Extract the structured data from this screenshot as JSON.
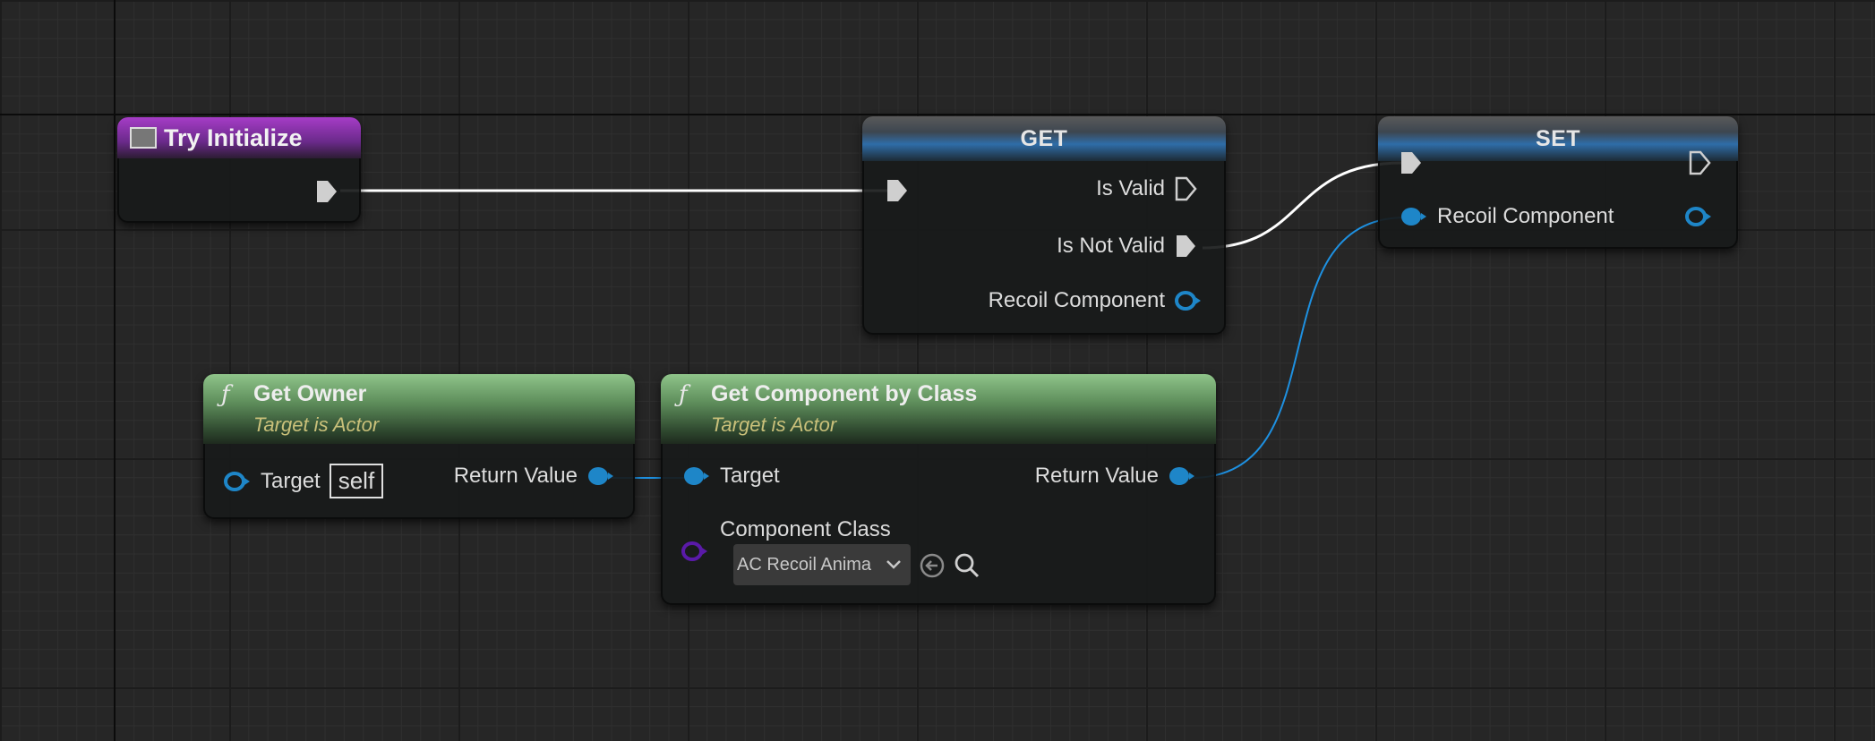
{
  "event_node": {
    "title": "Try Initialize"
  },
  "get_node": {
    "title": "GET",
    "pins": {
      "is_valid": "Is Valid",
      "is_not_valid": "Is Not Valid",
      "recoil_component": "Recoil Component"
    }
  },
  "set_node": {
    "title": "SET",
    "pins": {
      "recoil_component": "Recoil Component"
    }
  },
  "get_owner_node": {
    "title": "Get Owner",
    "subtitle": "Target is Actor",
    "pins": {
      "target": "Target",
      "target_value": "self",
      "return_value": "Return Value"
    }
  },
  "get_component_node": {
    "title": "Get Component by Class",
    "subtitle": "Target is Actor",
    "pins": {
      "target": "Target",
      "return_value": "Return Value",
      "component_class": "Component Class",
      "component_class_value": "AC Recoil Anima"
    }
  },
  "colors": {
    "exec": "#cfcfcf",
    "object_pin": "#1e86c8",
    "class_pin": "#5a1aa8",
    "exec_wire": "#ffffff",
    "data_wire": "#1e90e0"
  },
  "icons": {
    "event": "event-icon",
    "function": "function-icon",
    "use_selected": "arrow-left-circle-icon",
    "browse": "search-icon",
    "dropdown": "chevron-down-icon"
  }
}
